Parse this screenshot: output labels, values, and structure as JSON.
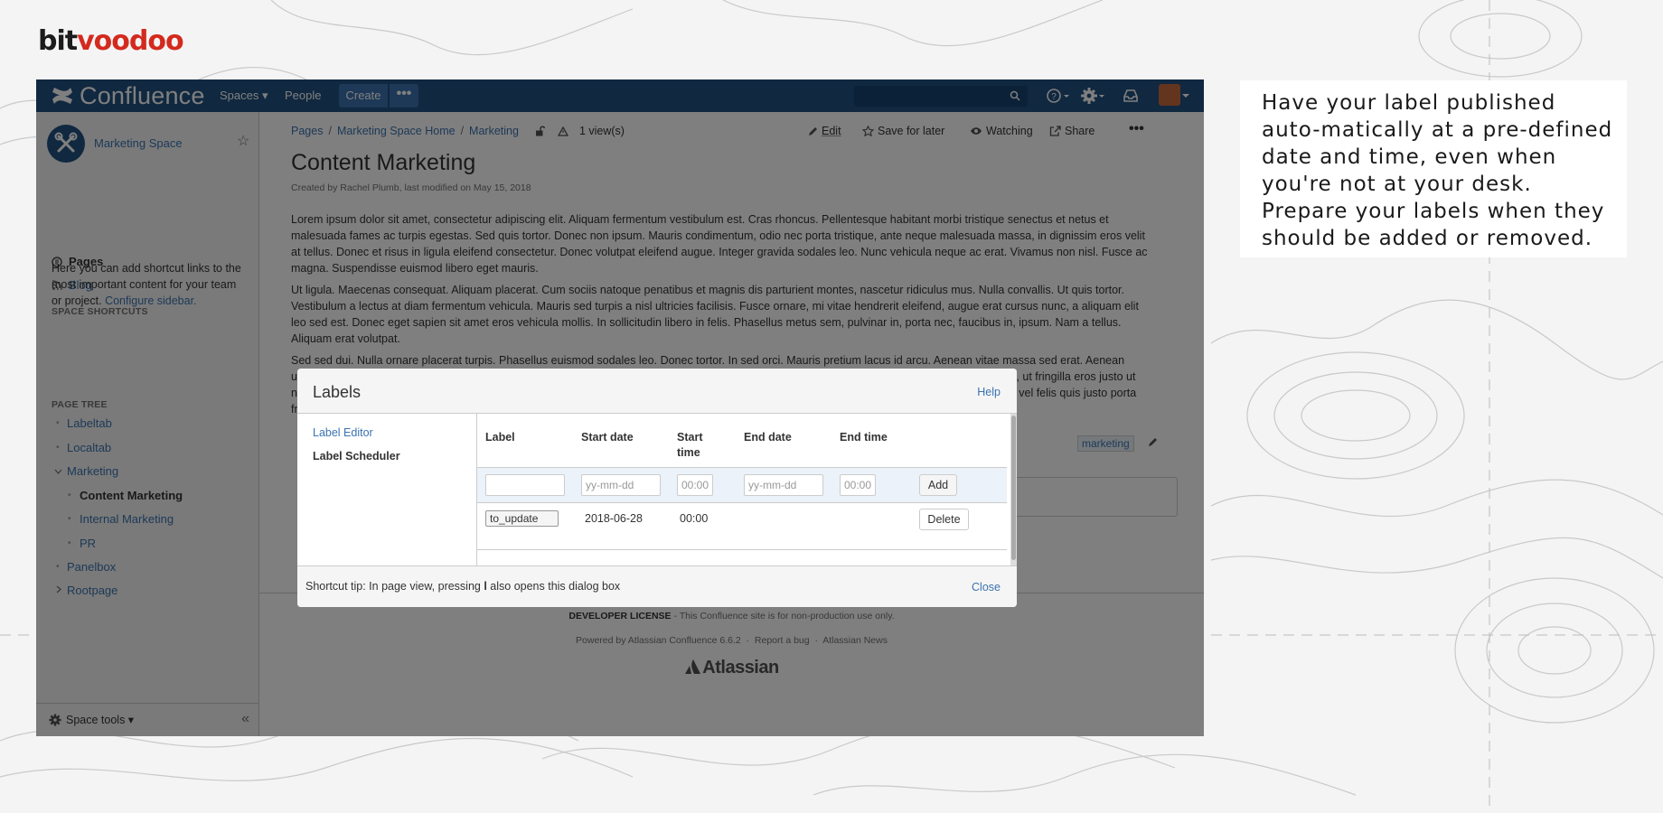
{
  "brand": {
    "part1": "bit",
    "part2": "voodoo"
  },
  "topnav": {
    "logo": "Confluence",
    "spaces": "Spaces ▾",
    "people": "People",
    "create": "Create",
    "more": "•••"
  },
  "sidebar": {
    "space_name": "Marketing Space",
    "nav": [
      "Pages",
      "Blog"
    ],
    "shortcuts_heading": "SPACE SHORTCUTS",
    "shortcuts_text": "Here you can add shortcut links to the most important content for your team or project.",
    "configure_link": "Configure sidebar.",
    "tree_heading": "PAGE TREE",
    "tree": [
      "Labeltab",
      "Localtab",
      "Marketing",
      "Content Marketing",
      "Internal Marketing",
      "PR",
      "Panelbox",
      "Rootpage"
    ],
    "space_tools": "Space tools ▾"
  },
  "page": {
    "breadcrumbs": [
      "Pages",
      "Marketing Space Home",
      "Marketing"
    ],
    "views": "1 view(s)",
    "actions": {
      "edit": "Edit",
      "save": "Save for later",
      "watching": "Watching",
      "share": "Share"
    },
    "title": "Content Marketing",
    "byline": "Created by Rachel Plumb, last modified on May 15, 2018",
    "para1": "Lorem ipsum dolor sit amet, consectetur adipiscing elit. Aliquam fermentum vestibulum est. Cras rhoncus. Pellentesque habitant morbi tristique senectus et netus et malesuada fames ac turpis egestas. Sed quis tortor. Donec non ipsum. Mauris condimentum, odio nec porta tristique, ante neque malesuada massa, in dignissim eros velit at tellus. Donec et risus in ligula eleifend consectetur. Donec volutpat eleifend augue. Integer gravida sodales leo. Nunc vehicula neque ac erat. Vivamus non nisl. Fusce ac magna. Suspendisse euismod libero eget mauris.",
    "para2": "Ut ligula. Maecenas consequat. Aliquam placerat. Cum sociis natoque penatibus et magnis dis parturient montes, nascetur ridiculus mus. Nulla convallis. Ut quis tortor. Vestibulum a lectus at diam fermentum vehicula. Mauris sed turpis a nisl ultricies facilisis. Fusce ornare, mi vitae hendrerit eleifend, augue erat cursus nunc, a aliquam elit leo sed est. Donec eget sapien sit amet eros vehicula mollis. In sollicitudin libero in felis. Phasellus metus sem, pulvinar in, porta nec, faucibus in, ipsum. Nam a tellus. Aliquam erat volutpat.",
    "para3": "Sed sed dui. Nulla ornare placerat turpis. Phasellus euismod sodales leo. Donec tortor. In sed orci. Mauris pretium lacus id arcu. Aenean vitae massa sed erat. Aenean ultrices dolor ac mauris. Nulla facilisi. Morbi dictum tincidunt mauris. Donec in magna. Aenean faucibus lorem et nulla. Duis et orci dignissim diam, ut fringilla eros justo ut neque. Duis suscipit nisl quis est. Fusce sit amet velit. Suspendisse vestibulum lacus vel dolor lacinia mollis. Sed cursus lacus nec ligula. Aenean vel felis quis justo porta fringilla.",
    "tag": "marketing"
  },
  "footer": {
    "license_bold": "DEVELOPER LICENSE",
    "license_text": " - This Confluence site is for non-production use only.",
    "powered": "Powered by Atlassian Confluence 6.6.2",
    "report": "Report a bug",
    "news": "Atlassian News",
    "logo": "Atlassian"
  },
  "dialog": {
    "title": "Labels",
    "help": "Help",
    "nav": [
      "Label Editor",
      "Label Scheduler"
    ],
    "columns": [
      "Label",
      "Start date",
      "Start time",
      "End date",
      "End time"
    ],
    "placeholders": {
      "start_date": "yy-mm-dd",
      "start_time": "00:00",
      "end_date": "yy-mm-dd",
      "end_time": "00:00"
    },
    "add": "Add",
    "row": {
      "label": "to_update",
      "start_date": "2018-06-28",
      "start_time": "00:00",
      "end_date": "",
      "end_time": "",
      "action": "Delete"
    },
    "tip_before": "Shortcut tip: In page view, pressing ",
    "tip_key": "l",
    "tip_after": " also opens this dialog box",
    "close": "Close"
  },
  "callout": {
    "text": "Have your label published auto-matically at a pre-defined date and time, even when you're not at your desk. Prepare your labels when they should be added or removed."
  },
  "colors": {
    "nav": "#205081",
    "link": "#3b73af",
    "brand_red": "#d42a1e"
  }
}
